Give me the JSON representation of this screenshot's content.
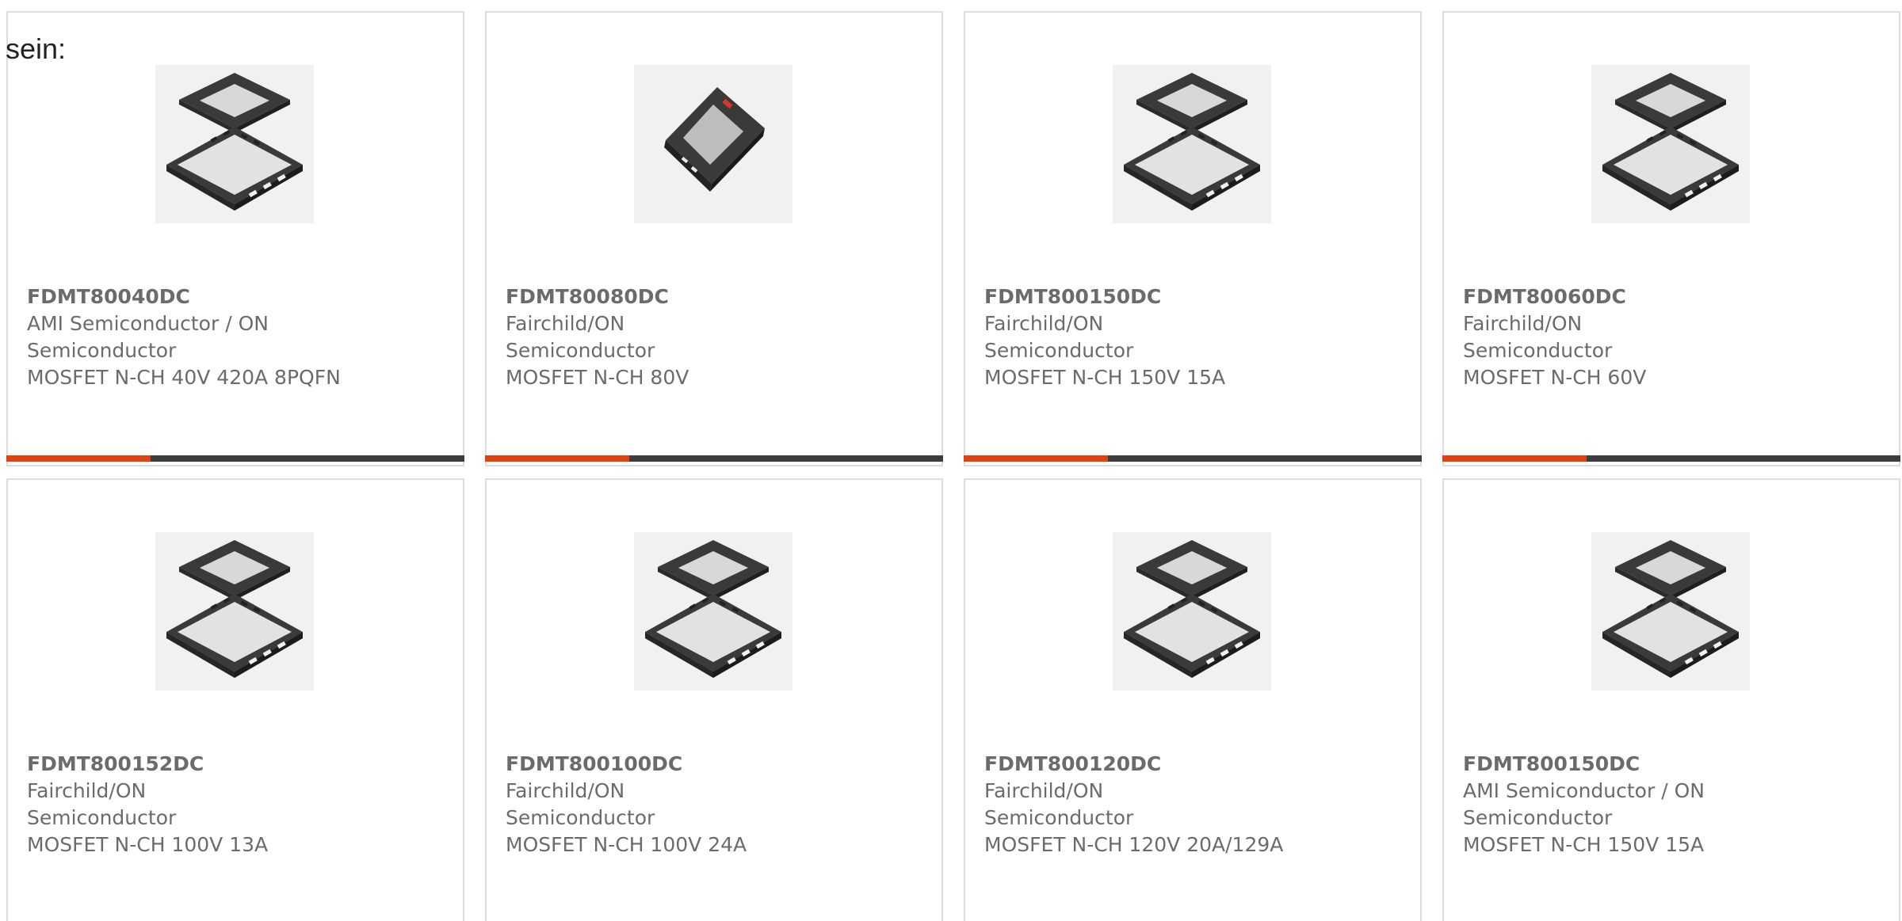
{
  "intro_text": "sein:",
  "colors": {
    "accent": "#e2420f",
    "bar": "#3d3d3d",
    "text": "#6b6b6b",
    "border": "#dcdcdc"
  },
  "products": [
    {
      "part": "FDMT80040DC",
      "manufacturer": "AMI Semiconductor / ON Semiconductor",
      "description": "MOSFET N-CH 40V 420A 8PQFN",
      "image": "exploded-qfn-package",
      "has_bar": true
    },
    {
      "part": "FDMT80080DC",
      "manufacturer": "Fairchild/ON Semiconductor",
      "description": "MOSFET N-CH 80V",
      "image": "tilted-qfn-package",
      "has_bar": true
    },
    {
      "part": "FDMT800150DC",
      "manufacturer": "Fairchild/ON Semiconductor",
      "description": "MOSFET N-CH 150V 15A",
      "image": "exploded-qfn-package",
      "has_bar": true
    },
    {
      "part": "FDMT80060DC",
      "manufacturer": "Fairchild/ON Semiconductor",
      "description": "MOSFET N-CH 60V",
      "image": "exploded-qfn-package",
      "has_bar": true
    },
    {
      "part": "FDMT800152DC",
      "manufacturer": "Fairchild/ON Semiconductor",
      "description": "MOSFET N-CH 100V 13A",
      "image": "exploded-qfn-package",
      "has_bar": false
    },
    {
      "part": "FDMT800100DC",
      "manufacturer": "Fairchild/ON Semiconductor",
      "description": "MOSFET N-CH 100V 24A",
      "image": "exploded-qfn-package",
      "has_bar": false
    },
    {
      "part": "FDMT800120DC",
      "manufacturer": "Fairchild/ON Semiconductor",
      "description": "MOSFET N-CH 120V 20A/129A",
      "image": "exploded-qfn-package",
      "has_bar": false
    },
    {
      "part": "FDMT800150DC",
      "manufacturer": "AMI Semiconductor / ON Semiconductor",
      "description": "MOSFET N-CH 150V 15A",
      "image": "exploded-qfn-package",
      "has_bar": false
    }
  ]
}
